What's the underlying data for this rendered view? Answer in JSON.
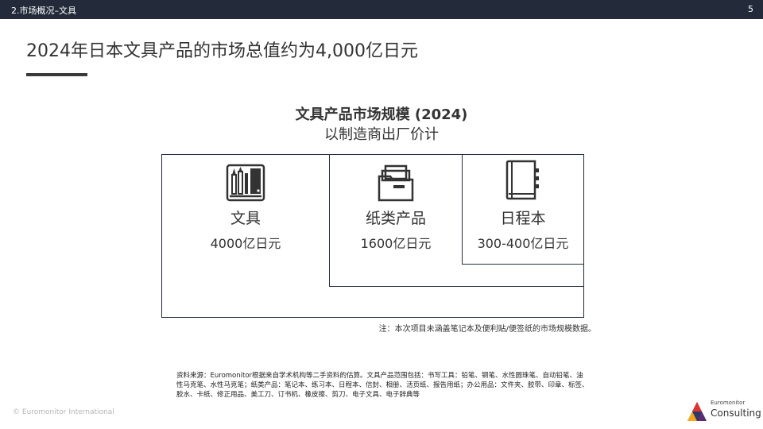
{
  "header": {
    "section": "2.市场概况–文具",
    "page_number": "5"
  },
  "slide_title": "2024年日本文具产品的市场总值约为4,000亿日元",
  "chart": {
    "title": "文具产品市场规模 (2024)",
    "subtitle": "以制造商出厂价计",
    "segments": [
      {
        "icon": "stationery-tools-icon",
        "label": "文具",
        "value": "4000亿日元"
      },
      {
        "icon": "file-folder-icon",
        "label": "纸类产品",
        "value": "1600亿日元"
      },
      {
        "icon": "notebook-icon",
        "label": "日程本",
        "value": "300-400亿日元"
      }
    ]
  },
  "note": "注：本次项目未涵盖笔记本及便利贴/便签纸的市场规模数据。",
  "source": "资料来源：Euromonitor根据来自学术机构等二手资料的估算。文具产品范围包括：书写工具：铅笔、钢笔、水性圆珠笔、自动铅笔、油性马克笔、水性马克笔；纸类产品：笔记本、练习本、日程本、信封、相册、活页纸、报告用纸；办公用品：文件夹、胶带、印章、标签、胶水、卡纸、修正用品、美工刀、订书机、橡皮擦、剪刀、电子文具、电子辞典等",
  "footer": {
    "copyright": "© Euromonitor International",
    "logo_small": "Euromonitor",
    "logo_big": "Consulting"
  },
  "colors": {
    "header_bg": "#232b3a",
    "box_border": "#232b3a",
    "text": "#333333"
  }
}
